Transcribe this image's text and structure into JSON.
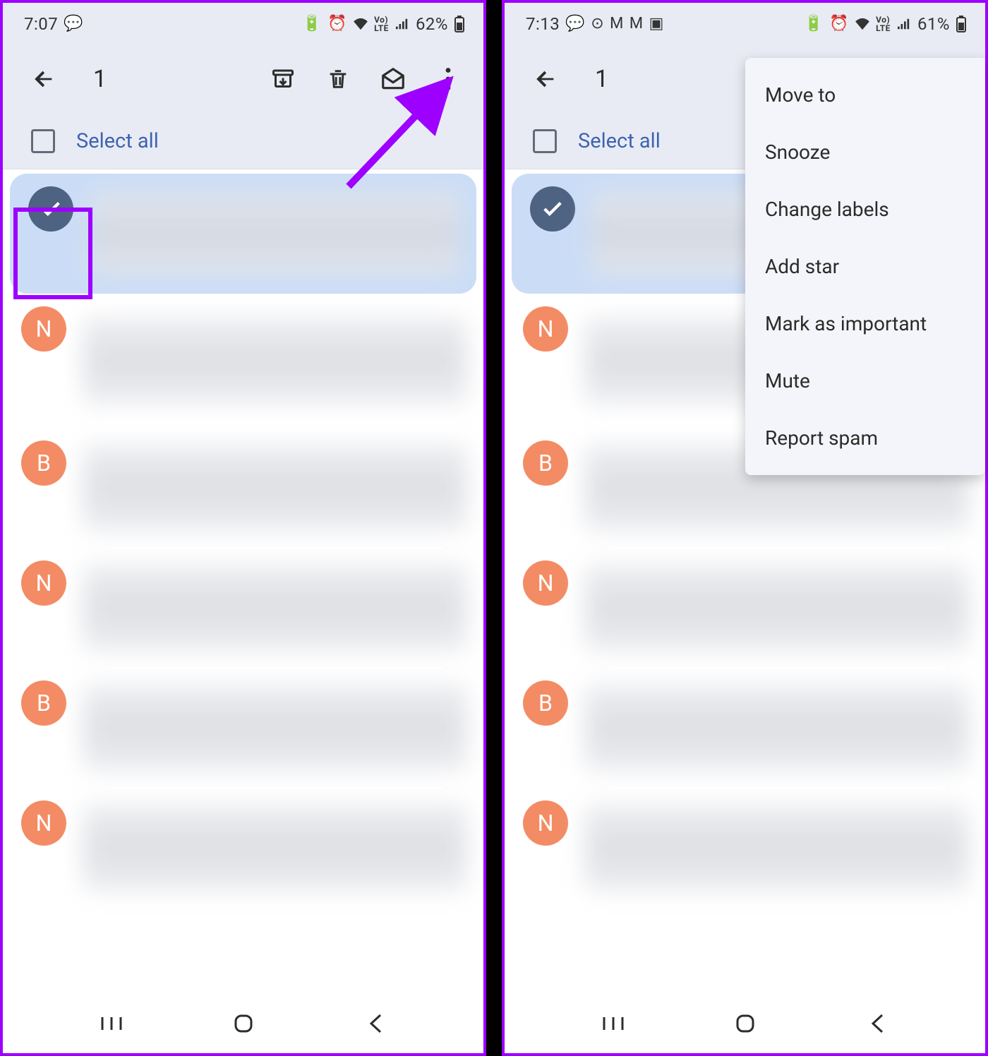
{
  "left": {
    "status": {
      "time": "7:07",
      "battery": "62%",
      "icons": [
        "chat",
        "reminder",
        "alarm",
        "wifi",
        "volte",
        "signal"
      ]
    },
    "appbar": {
      "count": "1"
    },
    "select_all": "Select all",
    "rows": [
      {
        "avatar": "check",
        "letter": "",
        "selected": true
      },
      {
        "avatar": "n",
        "letter": "N"
      },
      {
        "avatar": "b",
        "letter": "B"
      },
      {
        "avatar": "n",
        "letter": "N"
      },
      {
        "avatar": "b",
        "letter": "B"
      },
      {
        "avatar": "n",
        "letter": "N"
      }
    ]
  },
  "right": {
    "status": {
      "time": "7:13",
      "battery": "61%",
      "icons": [
        "chat",
        "whatsapp",
        "gmail",
        "gmail",
        "image",
        "reminder",
        "alarm",
        "wifi",
        "volte",
        "signal"
      ]
    },
    "appbar": {
      "count": "1"
    },
    "select_all": "Select all",
    "menu": {
      "items": [
        "Move to",
        "Snooze",
        "Change labels",
        "Add star",
        "Mark as important",
        "Mute",
        "Report spam"
      ]
    },
    "rows": [
      {
        "avatar": "check",
        "letter": "",
        "selected": true
      },
      {
        "avatar": "n",
        "letter": "N"
      },
      {
        "avatar": "b",
        "letter": "B"
      },
      {
        "avatar": "n",
        "letter": "N"
      },
      {
        "avatar": "b",
        "letter": "B"
      },
      {
        "avatar": "n",
        "letter": "N"
      }
    ]
  },
  "annotations": {
    "arrow_color": "#9d00ff"
  }
}
